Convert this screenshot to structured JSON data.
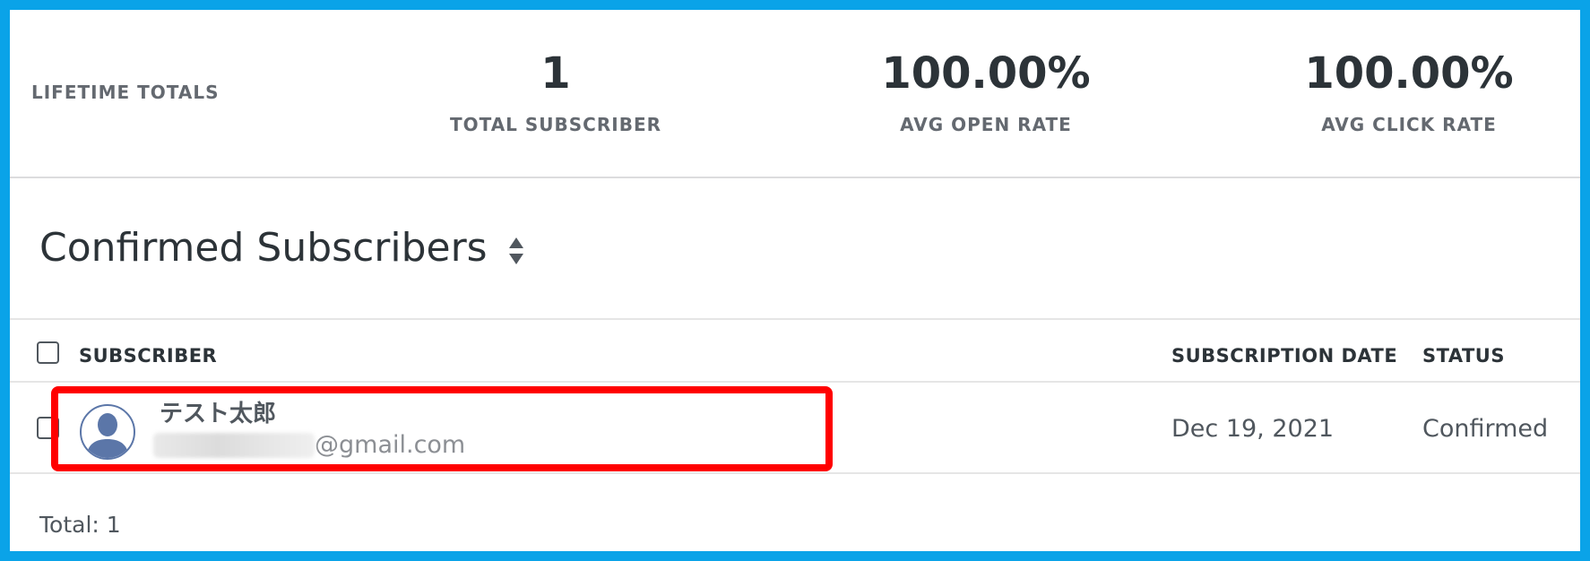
{
  "stats": {
    "lifetime_label": "LIFETIME TOTALS",
    "items": [
      {
        "value": "1",
        "label": "TOTAL SUBSCRIBER"
      },
      {
        "value": "100.00%",
        "label": "AVG OPEN RATE"
      },
      {
        "value": "100.00%",
        "label": "AVG CLICK RATE"
      }
    ]
  },
  "section": {
    "title": "Confirmed Subscribers",
    "sort_icon": "sort-updown-icon"
  },
  "table": {
    "columns": {
      "subscriber": "SUBSCRIBER",
      "date": "SUBSCRIPTION DATE",
      "status": "STATUS"
    },
    "rows": [
      {
        "name": "テスト太郎",
        "email_domain": "@gmail.com",
        "date": "Dec 19, 2021",
        "status": "Confirmed",
        "avatar_icon": "user-avatar-icon"
      }
    ]
  },
  "footer": {
    "total": "Total: 1"
  },
  "colors": {
    "frame": "#0aa3e8",
    "highlight": "#ff0000",
    "avatar": "#5b76a8"
  }
}
